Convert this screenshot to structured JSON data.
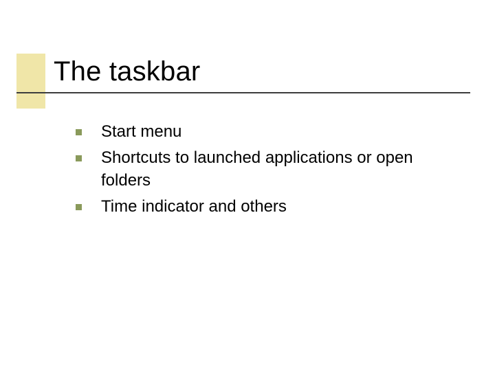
{
  "title": "The taskbar",
  "bullets": {
    "0": {
      "text": "Start menu"
    },
    "1": {
      "text": "Shortcuts to launched applications or open folders"
    },
    "2": {
      "text": "Time indicator and others"
    }
  },
  "colors": {
    "accent_block": "#f0e6a8",
    "rule": "#3c3c3c",
    "bullet": "#8a9a5b",
    "text": "#000000"
  }
}
